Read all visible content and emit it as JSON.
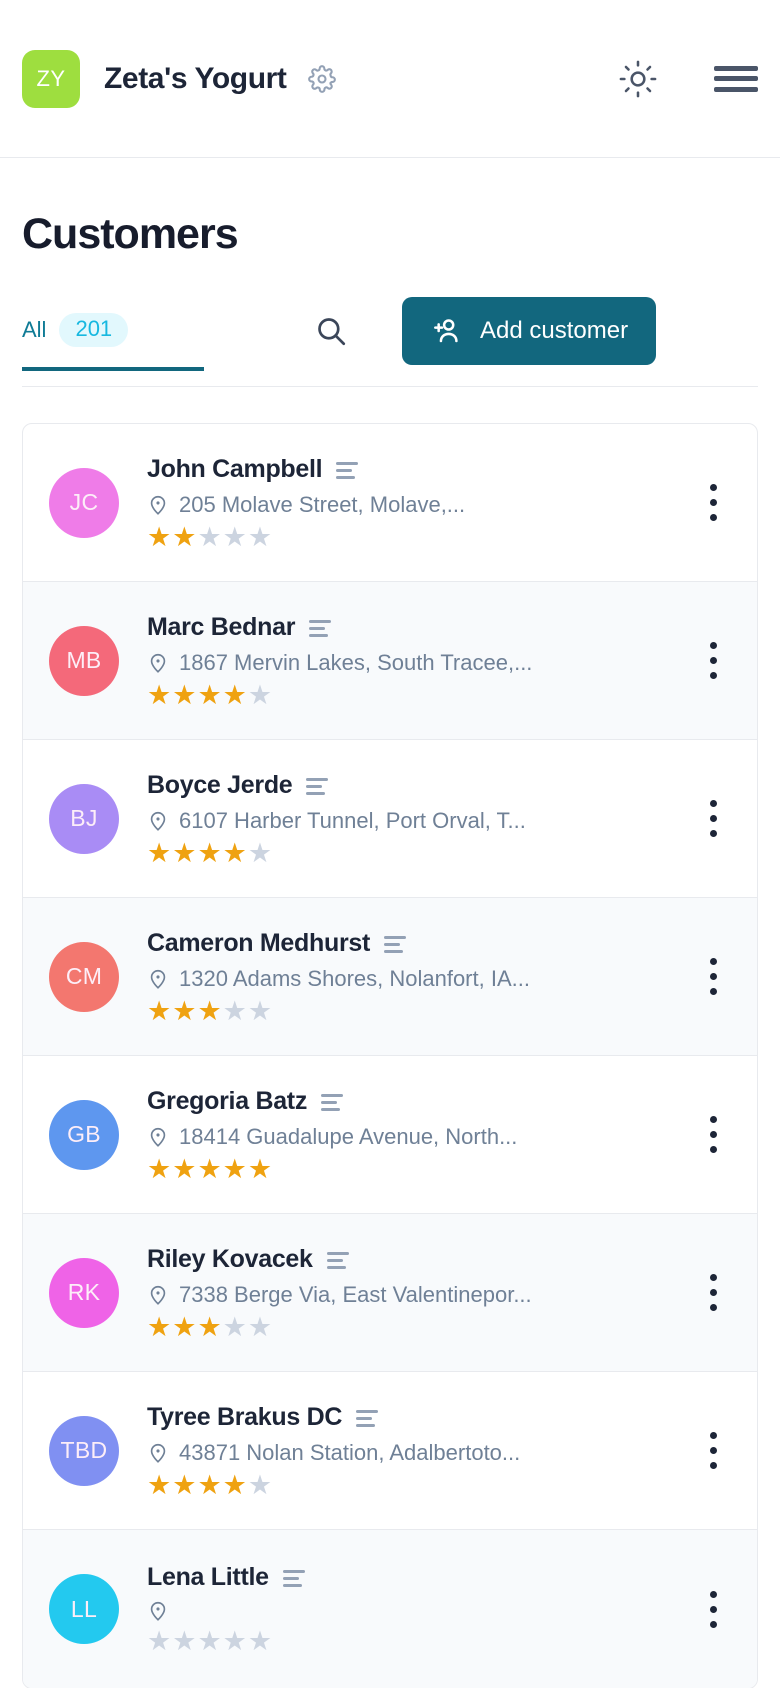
{
  "header": {
    "logo_initials": "ZY",
    "logo_color": "#9ede3f",
    "brand": "Zeta's Yogurt",
    "gear_icon": "gear-icon",
    "theme_icon": "sun-icon",
    "menu_icon": "hamburger-menu-icon"
  },
  "page": {
    "title": "Customers"
  },
  "toolbar": {
    "tab_label": "All",
    "tab_count": "201",
    "search_icon": "search-icon",
    "add_label": "Add customer",
    "add_icon": "add-person-icon",
    "accent_color": "#12677e",
    "badge_text_color": "#17b8e0",
    "badge_bg_color": "#e2f8fd"
  },
  "customers": [
    {
      "initials": "JC",
      "avatar_color": "#ef7ce8",
      "name": "John Campbell",
      "address": "205 Molave Street, Molave,...",
      "rating": 2
    },
    {
      "initials": "MB",
      "avatar_color": "#f4697a",
      "name": "Marc Bednar",
      "address": "1867 Mervin Lakes, South Tracee,...",
      "rating": 4
    },
    {
      "initials": "BJ",
      "avatar_color": "#a98cf5",
      "name": "Boyce Jerde",
      "address": "6107 Harber Tunnel, Port Orval, T...",
      "rating": 4
    },
    {
      "initials": "CM",
      "avatar_color": "#f3776f",
      "name": "Cameron Medhurst",
      "address": "1320 Adams Shores, Nolanfort, IA...",
      "rating": 3
    },
    {
      "initials": "GB",
      "avatar_color": "#5e97ef",
      "name": "Gregoria Batz",
      "address": "18414 Guadalupe Avenue, North...",
      "rating": 5
    },
    {
      "initials": "RK",
      "avatar_color": "#ef63e7",
      "name": "Riley Kovacek",
      "address": "7338 Berge Via, East Valentinepor...",
      "rating": 3
    },
    {
      "initials": "TBD",
      "avatar_color": "#8090f2",
      "name": "Tyree Brakus DC",
      "address": "43871 Nolan Station, Adalbertoto...",
      "rating": 4
    },
    {
      "initials": "LL",
      "avatar_color": "#23c9ef",
      "name": "Lena Little",
      "address": "",
      "rating": 0
    }
  ]
}
